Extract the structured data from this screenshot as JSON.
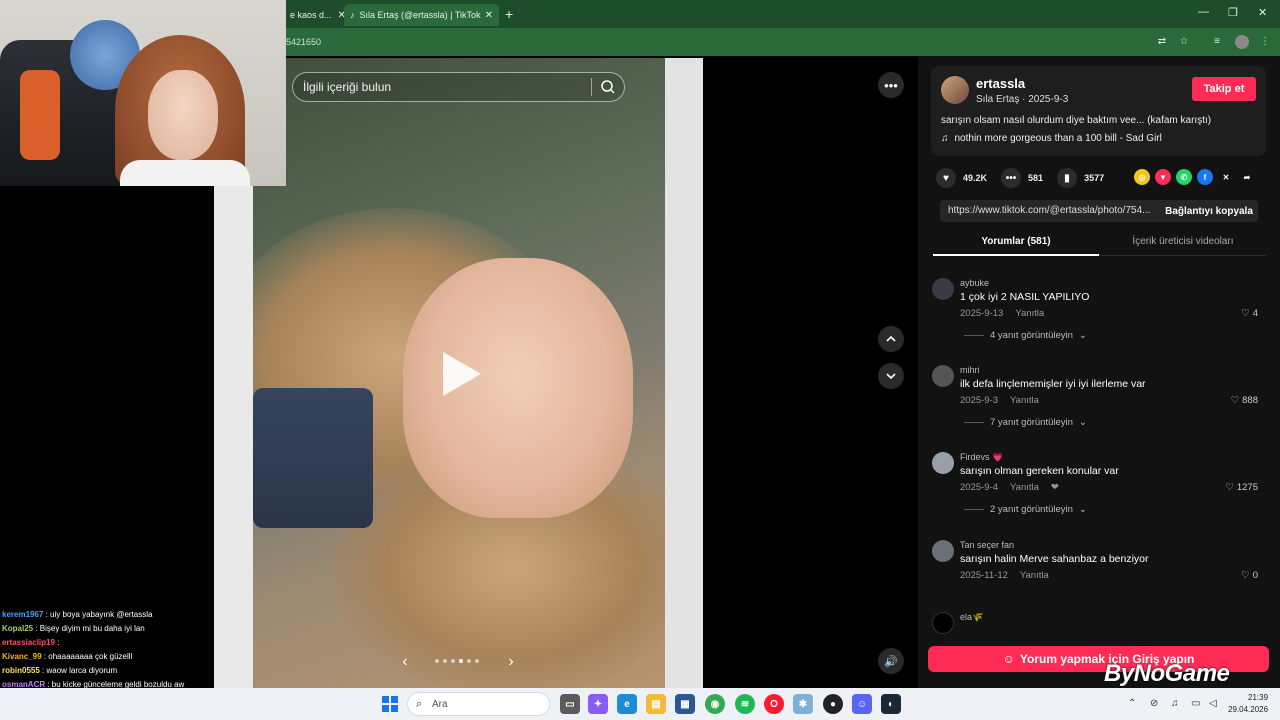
{
  "browser": {
    "tabs": [
      {
        "label": "e kaos d...",
        "active": false
      },
      {
        "label": "Sıla Ertaş (@ertassla) | TikTok",
        "active": true
      }
    ],
    "new_tab": "+",
    "url_fragment": "5421650",
    "window_controls": [
      "—",
      "❐",
      "✕"
    ]
  },
  "tiktok": {
    "search_placeholder": "İlgili içeriği bulun",
    "more_button": "•••",
    "nav_up": "⌃",
    "nav_down": "⌄",
    "sound_icon": "speaker-icon",
    "pager": {
      "total_dots": 6,
      "active_index": 3
    },
    "post": {
      "username": "ertassla",
      "subline": "Sıla Ertaş · 2025-9-3",
      "follow_label": "Takip et",
      "caption": "sarışın olsam nasıl olurdum diye baktım vee... (kafam karıştı)",
      "music": "nothin more gorgeous than a 100 bill - Sad Girl",
      "likes": "49.2K",
      "comments": "581",
      "saves": "3577",
      "link": "https://www.tiktok.com/@ertassla/photo/754...",
      "copy_label": "Bağlantıyı kopyala"
    },
    "tabs": {
      "comments": "Yorumlar (581)",
      "creator_videos": "İçerik üreticisi videoları"
    },
    "comments": [
      {
        "user": "aybuke",
        "text": "1 çok iyi 2 NASIL YAPILIYO",
        "date": "2025-9-13",
        "reply": "Yanıtla",
        "likes": "4",
        "replies": "4 yanıt görüntüleyin"
      },
      {
        "user": "mihri",
        "text": "ilk defa linçlememişler iyi iyi ilerleme var",
        "date": "2025-9-3",
        "reply": "Yanıtla",
        "likes": "888",
        "replies": "7 yanıt görüntüleyin"
      },
      {
        "user": "Firdevs 💗",
        "text": "sarışın olman gereken konular var",
        "date": "2025-9-4",
        "reply": "Yanıtla",
        "likes": "1275",
        "replies": "2 yanıt görüntüleyin"
      },
      {
        "user": "Tan seçer fan",
        "text": "sarışın halin Merve sahanbaz a benziyor",
        "date": "2025-11-12",
        "reply": "Yanıtla",
        "likes": "0",
        "replies": ""
      }
    ],
    "partial_comment_user": "ela🌾",
    "login_label": "Yorum yapmak için Giriş yapın"
  },
  "watermark": "ByNoGame",
  "chat": [
    {
      "user": "kerem1967",
      "msg": ": uiy boya yabayınk @ertassla",
      "color": "#3fa7ff"
    },
    {
      "user": "Kopal25",
      "msg": ": Bişey diyim mi bu daha iyi lan",
      "color": "#9ad36a"
    },
    {
      "user": "ertassiaclip19",
      "msg": ":",
      "color": "#ff4d6d"
    },
    {
      "user": "Kivanc_99",
      "msg": ": ohaaaaaaaa çok güzelll",
      "color": "#ffb020"
    },
    {
      "user": "robin0555",
      "msg": ": waow larca diyorum",
      "color": "#f5e663"
    },
    {
      "user": "osmanACR",
      "msg": ": bu kicke günceleme geldi bozuldu aw",
      "color": "#c77dff"
    }
  ],
  "taskbar": {
    "search_placeholder": "Ara",
    "time": "21:39",
    "date": "29.04.2026"
  },
  "colors": {
    "tiktok_red": "#fe2c55",
    "chrome_green": "#2a6a3a"
  }
}
